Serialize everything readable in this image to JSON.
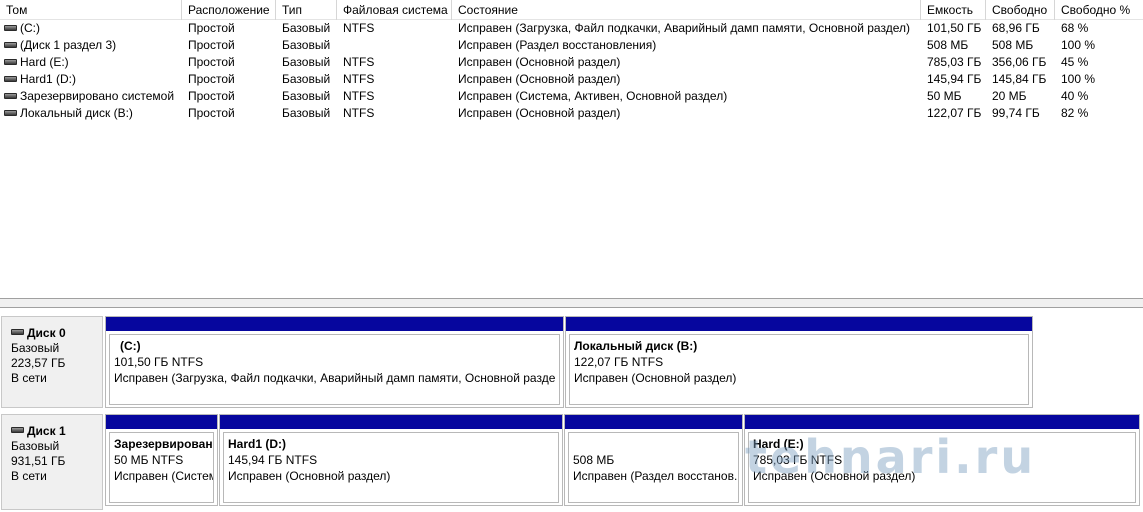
{
  "table": {
    "columns": [
      "Том",
      "Расположение",
      "Тип",
      "Файловая система",
      "Состояние",
      "Емкость",
      "Свободно",
      "Свободно %"
    ],
    "rows": [
      {
        "name": "(C:)",
        "layout": "Простой",
        "type": "Базовый",
        "fs": "NTFS",
        "status": "Исправен (Загрузка, Файл подкачки, Аварийный дамп памяти, Основной раздел)",
        "capacity": "101,50 ГБ",
        "free": "68,96 ГБ",
        "free_pct": "68 %"
      },
      {
        "name": "(Диск 1 раздел 3)",
        "layout": "Простой",
        "type": "Базовый",
        "fs": "",
        "status": "Исправен (Раздел восстановления)",
        "capacity": "508 МБ",
        "free": "508 МБ",
        "free_pct": "100 %"
      },
      {
        "name": "Hard (E:)",
        "layout": "Простой",
        "type": "Базовый",
        "fs": "NTFS",
        "status": "Исправен (Основной раздел)",
        "capacity": "785,03 ГБ",
        "free": "356,06 ГБ",
        "free_pct": "45 %"
      },
      {
        "name": "Hard1 (D:)",
        "layout": "Простой",
        "type": "Базовый",
        "fs": "NTFS",
        "status": "Исправен (Основной раздел)",
        "capacity": "145,94 ГБ",
        "free": "145,84 ГБ",
        "free_pct": "100 %"
      },
      {
        "name": "Зарезервировано системой",
        "layout": "Простой",
        "type": "Базовый",
        "fs": "NTFS",
        "status": "Исправен (Система, Активен, Основной раздел)",
        "capacity": "50 МБ",
        "free": "20 МБ",
        "free_pct": "40 %"
      },
      {
        "name": "Локальный диск (B:)",
        "layout": "Простой",
        "type": "Базовый",
        "fs": "NTFS",
        "status": "Исправен (Основной раздел)",
        "capacity": "122,07 ГБ",
        "free": "99,74 ГБ",
        "free_pct": "82 %"
      }
    ]
  },
  "disks": [
    {
      "title": "Диск 0",
      "type": "Базовый",
      "size": "223,57 ГБ",
      "state": "В сети",
      "partitions": [
        {
          "name": "(C:)",
          "size_fs": "101,50 ГБ NTFS",
          "status": "Исправен (Загрузка, Файл подкачки, Аварийный дамп памяти, Основной разде"
        },
        {
          "name": "Локальный диск  (B:)",
          "size_fs": "122,07 ГБ NTFS",
          "status": "Исправен (Основной раздел)"
        }
      ]
    },
    {
      "title": "Диск 1",
      "type": "Базовый",
      "size": "931,51 ГБ",
      "state": "В сети",
      "partitions": [
        {
          "name": "Зарезервирован",
          "size_fs": "50 МБ NTFS",
          "status": "Исправен (Систем"
        },
        {
          "name": "Hard1  (D:)",
          "size_fs": "145,94 ГБ NTFS",
          "status": "Исправен (Основной раздел)"
        },
        {
          "name": "",
          "size_fs": "508 МБ",
          "status": "Исправен (Раздел восстанов."
        },
        {
          "name": "Hard  (E:)",
          "size_fs": "785,03 ГБ NTFS",
          "status": "Исправен (Основной раздел)"
        }
      ]
    }
  ],
  "colors": {
    "partition_bar": "#06069e",
    "info_panel": "#f0f0f0"
  },
  "icons": {
    "volume": "drive-icon",
    "disk": "disk-icon"
  },
  "watermark": "tehnari.ru"
}
